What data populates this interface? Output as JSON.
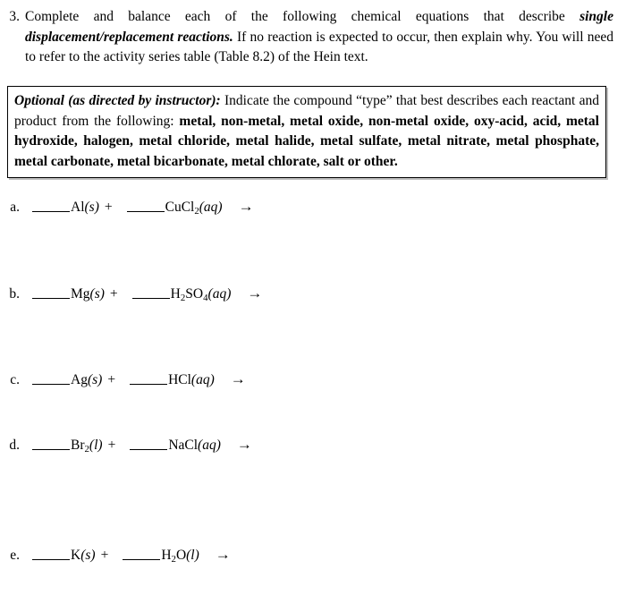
{
  "intro": {
    "marker": "3.",
    "text_part1": "Complete and balance each of the following chemical equations that describe ",
    "emphasis": "single displacement/replacement reactions.",
    "text_part2": " If no reaction is expected to occur, then explain why.  You will need to refer to the activity series table (Table 8.2) of the Hein text."
  },
  "optional_box": {
    "lead": "Optional (as directed by instructor):",
    "text": " Indicate the compound “type” that best describes each reactant and product from the following: ",
    "types": " metal, non-metal, metal oxide, non-metal oxide, oxy-acid, acid, metal hydroxide, halogen, metal chloride, metal halide, metal sulfate, metal nitrate, metal phosphate, metal carbonate, metal bicarbonate, metal chlorate, salt",
    "tail": " or other."
  },
  "symbols": {
    "plus": "+",
    "arrow": "→",
    "blank": ""
  },
  "equations": [
    {
      "label": "a.",
      "reactant1": {
        "formula": "Al",
        "sub1": "",
        "state": "(s)"
      },
      "reactant2": {
        "formula": "CuCl",
        "sub1": "2",
        "state": "(aq)"
      }
    },
    {
      "label": "b.",
      "reactant1": {
        "formula": "Mg",
        "sub1": "",
        "state": "(s)"
      },
      "reactant2": {
        "formula": "H",
        "sub1": "2",
        "mid": "SO",
        "sub2": "4",
        "state": "(aq)"
      }
    },
    {
      "label": "c.",
      "reactant1": {
        "formula": "Ag",
        "sub1": "",
        "state": "(s)"
      },
      "reactant2": {
        "formula": "HCl",
        "sub1": "",
        "state": "(aq)"
      }
    },
    {
      "label": "d.",
      "reactant1": {
        "formula": "Br",
        "sub1": "2",
        "state": "(l)"
      },
      "reactant2": {
        "formula": "NaCl",
        "sub1": "",
        "state": "(aq)"
      }
    },
    {
      "label": "e.",
      "reactant1": {
        "formula": "K",
        "sub1": "",
        "state": "(s)"
      },
      "reactant2": {
        "formula": "H",
        "sub1": "2",
        "mid": "O",
        "sub2": "",
        "state": "(l)"
      }
    }
  ]
}
